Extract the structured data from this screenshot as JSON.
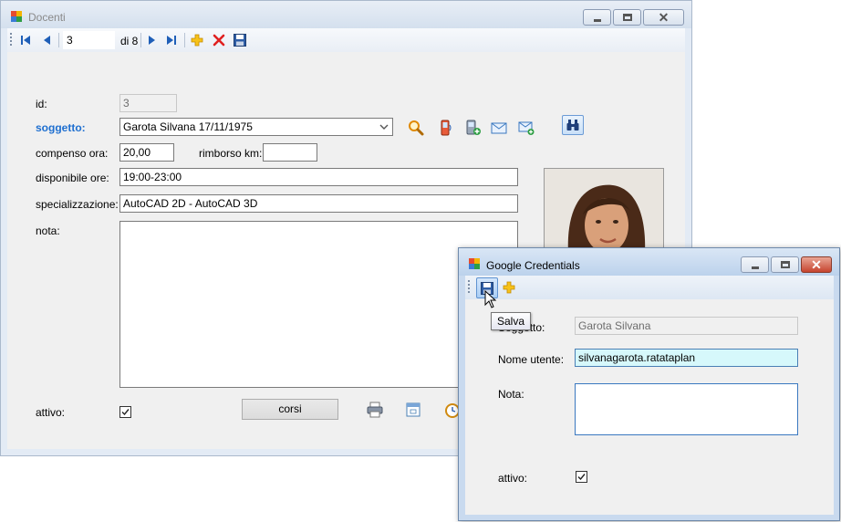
{
  "docenti": {
    "title": "Docenti",
    "nav": {
      "position": "3",
      "of_label": "di 8"
    },
    "labels": {
      "id": "id:",
      "soggetto": "soggetto:",
      "compenso": "compenso ora:",
      "rimborso": "rimborso km:",
      "disponibile": "disponibile ore:",
      "specializzazione": "specializzazione:",
      "nota": "nota:",
      "attivo": "attivo:"
    },
    "values": {
      "id": "3",
      "soggetto": "Garota Silvana 17/11/1975",
      "compenso": "20,00",
      "rimborso": "",
      "disponibile": "19:00-23:00",
      "specializzazione": "AutoCAD 2D - AutoCAD 3D",
      "nota": "",
      "attivo": true
    },
    "buttons": {
      "corsi": "corsi"
    },
    "icons": [
      "first-record-icon",
      "previous-record-icon",
      "next-record-icon",
      "last-record-icon",
      "add-icon",
      "delete-icon",
      "save-icon",
      "search-icon",
      "mobile-phone-icon",
      "phone-add-icon",
      "email-icon",
      "email-add-icon",
      "binoculars-icon",
      "print-icon",
      "calendar-icon",
      "clock-icon"
    ]
  },
  "google_credentials": {
    "title": "Google Credentials",
    "tooltip": "Salva",
    "labels": {
      "soggetto": "Soggetto:",
      "nome_utente": "Nome utente:",
      "nota": "Nota:",
      "attivo": "attivo:"
    },
    "values": {
      "soggetto": "Garota Silvana",
      "nome_utente": "silvanagarota.ratataplan",
      "nota": "",
      "attivo": true
    }
  },
  "colors": {
    "accent_label": "#1e6fd0",
    "highlight_field": "#d6f8fb",
    "close_button": "#c6442e"
  }
}
